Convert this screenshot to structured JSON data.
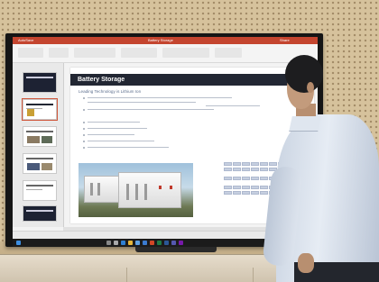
{
  "scene": {
    "kind": "photo of a presenter beside a large wall-mounted display",
    "colors": {
      "pegboard": "#d6c29c",
      "tv_bezel": "#151515",
      "app_accent": "#c4452f",
      "slide_header": "#222733"
    }
  },
  "app": {
    "window_title": "Battery Storage",
    "ribbon_left": "AutoSave",
    "ribbon_right": "Share"
  },
  "slide": {
    "title": "Battery Storage",
    "subtitle": "Leading Technology is Lithium Ion"
  },
  "thumbnails": [
    {
      "style": "dark"
    },
    {
      "style": "light",
      "selected": true
    },
    {
      "style": "light"
    },
    {
      "style": "light"
    },
    {
      "style": "light"
    },
    {
      "style": "dark"
    }
  ],
  "taskbar": {
    "icons": [
      "windows-icon",
      "search-icon",
      "task-view-icon",
      "edge-icon",
      "explorer-icon",
      "store-icon",
      "mail-icon",
      "powerpoint-icon",
      "excel-icon",
      "word-icon",
      "teams-icon",
      "onenote-icon"
    ]
  }
}
